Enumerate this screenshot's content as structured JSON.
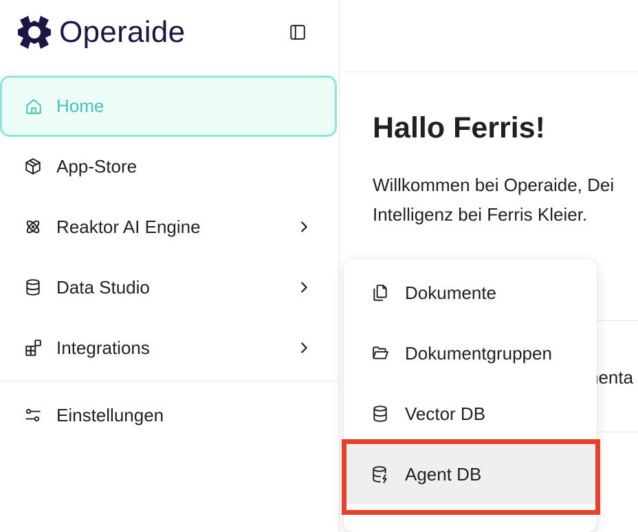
{
  "brand": {
    "name": "Operaide",
    "color": "#1a1745"
  },
  "sidebar": {
    "items": [
      {
        "label": "Home",
        "icon": "home-icon",
        "active": true,
        "has_submenu": false
      },
      {
        "label": "App-Store",
        "icon": "package-icon",
        "active": false,
        "has_submenu": false
      },
      {
        "label": "Reaktor AI Engine",
        "icon": "atom-icon",
        "active": false,
        "has_submenu": true
      },
      {
        "label": "Data Studio",
        "icon": "database-icon",
        "active": false,
        "has_submenu": true
      },
      {
        "label": "Integrations",
        "icon": "blocks-icon",
        "active": false,
        "has_submenu": true
      }
    ],
    "settings": {
      "label": "Einstellungen",
      "icon": "sliders-icon"
    }
  },
  "main": {
    "greeting": "Hallo Ferris!",
    "welcome_line1": "Willkommen bei Operaide, Dei",
    "welcome_line2": "Intelligenz bei Ferris Kleier.",
    "partial_text": "nenta"
  },
  "data_studio_menu": {
    "items": [
      {
        "label": "Dokumente",
        "icon": "files-icon"
      },
      {
        "label": "Dokumentgruppen",
        "icon": "folder-open-icon"
      },
      {
        "label": "Vector DB",
        "icon": "database-icon"
      },
      {
        "label": "Agent DB",
        "icon": "database-zap-icon",
        "highlighted": true
      }
    ]
  },
  "colors": {
    "accent": "#47c1b6",
    "active_border": "#8de6da",
    "active_bg": "#ecfdf8",
    "annotation": "#e8412a"
  }
}
